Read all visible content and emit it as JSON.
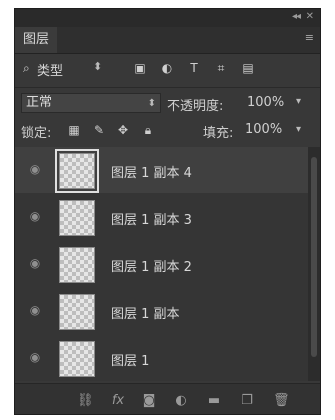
{
  "panel": {
    "collapse_icon": "double-chevron-icon",
    "close_icon": "close-icon",
    "tab_title": "图层",
    "menu_icon": "panel-menu-icon"
  },
  "filter": {
    "search_icon": "search-icon",
    "kind_label": "类型",
    "icons": [
      "image-filter-icon",
      "adjustment-filter-icon",
      "type-filter-icon",
      "shape-filter-icon",
      "smart-object-filter-icon"
    ]
  },
  "blend": {
    "mode": "正常",
    "opacity_label": "不透明度:",
    "opacity_value": "100%"
  },
  "lock": {
    "label": "锁定:",
    "icons": [
      "lock-transparent-icon",
      "lock-paint-icon",
      "lock-move-icon",
      "lock-all-icon"
    ],
    "fill_label": "填充:",
    "fill_value": "100%"
  },
  "layers": [
    {
      "name": "图层 1 副本 4",
      "selected": true
    },
    {
      "name": "图层 1 副本 3",
      "selected": false
    },
    {
      "name": "图层 1 副本 2",
      "selected": false
    },
    {
      "name": "图层 1 副本",
      "selected": false
    },
    {
      "name": "图层 1",
      "selected": false
    }
  ],
  "bottom_bar": {
    "fx_label": "fx"
  },
  "colors": {
    "panel_bg": "#383838",
    "text": "#d8d8d8"
  }
}
